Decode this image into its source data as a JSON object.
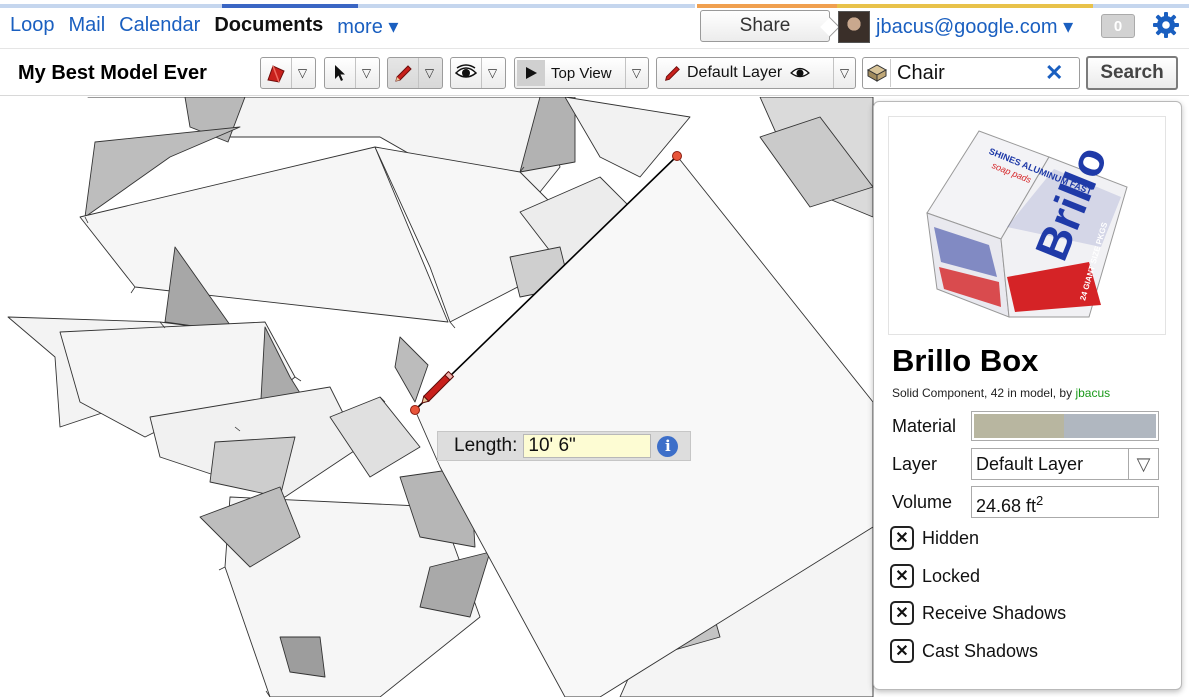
{
  "nav": {
    "links": [
      "Loop",
      "Mail",
      "Calendar",
      "Documents",
      "more ▾"
    ],
    "active_index": 3,
    "share_label": "Share",
    "account": "jbacus@google.com ▾",
    "count": "0",
    "accent_colors": [
      "#c5d6ee",
      "#f0a050",
      "#e8c24a",
      "#c5d6ee"
    ]
  },
  "toolbar": {
    "model_title": "My Best Model Ever",
    "view_label": "Top View",
    "layer_label": "Default Layer",
    "search_value": "Chair",
    "search_button": "Search",
    "clear_symbol": "✕",
    "dropdown_symbol": "▽"
  },
  "measure": {
    "label": "Length:",
    "value": "10' 6\"",
    "info_symbol": "i"
  },
  "inspector": {
    "name": "Brillo Box",
    "desc_prefix": "Solid Component, 42 in model, by ",
    "owner": "jbacus",
    "material_label": "Material",
    "material_colors": [
      "#b8b6a0",
      "#b0b7c0"
    ],
    "layer_label": "Layer",
    "layer_value": "Default Layer",
    "layer_dd": "▽",
    "volume_label": "Volume",
    "volume_value": "24.68 ft",
    "volume_exp": "2",
    "checkboxes": [
      {
        "label": "Hidden",
        "mark": "✕"
      },
      {
        "label": "Locked",
        "mark": "✕"
      },
      {
        "label": "Receive Shadows",
        "mark": "✕"
      },
      {
        "label": "Cast Shadows",
        "mark": "✕"
      }
    ],
    "thumb_text": {
      "brand": "Brillo",
      "line1": "24 GIANT SIZE PKGS",
      "line2": "SHINES ALUMINUM FAST",
      "line3": "soap pads"
    }
  }
}
